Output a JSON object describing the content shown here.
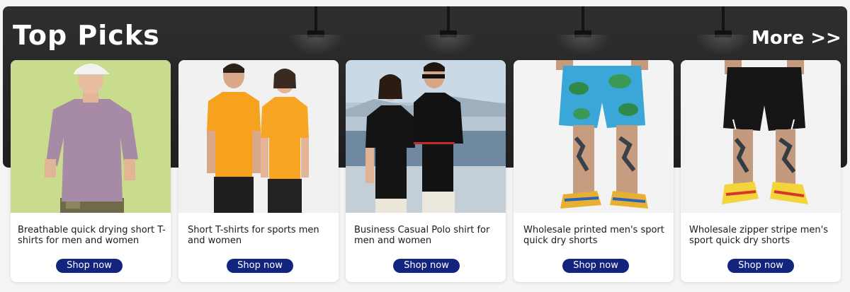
{
  "section": {
    "title": "Top Picks",
    "more_label": "More >>"
  },
  "cards": [
    {
      "description": "Breathable quick drying short T-shirts for men and women",
      "button": "Shop now",
      "image": "man-in-lavender-tshirt-photo"
    },
    {
      "description": "Short T-shirts for sports men and women",
      "button": "Shop now",
      "image": "couple-in-orange-sport-tshirts-photo"
    },
    {
      "description": "Business Casual Polo shirt for men and women",
      "button": "Shop now",
      "image": "couple-in-black-polo-shirts-photo"
    },
    {
      "description": "Wholesale printed men's sport quick dry shorts",
      "button": "Shop now",
      "image": "printed-sport-shorts-photo"
    },
    {
      "description": "Wholesale zipper stripe men's sport quick dry shorts",
      "button": "Shop now",
      "image": "black-striped-shorts-photo"
    }
  ],
  "colors": {
    "banner_bg": "#262626",
    "button_bg": "#13247f",
    "button_text": "#ffffff",
    "card_bg": "#ffffff"
  }
}
